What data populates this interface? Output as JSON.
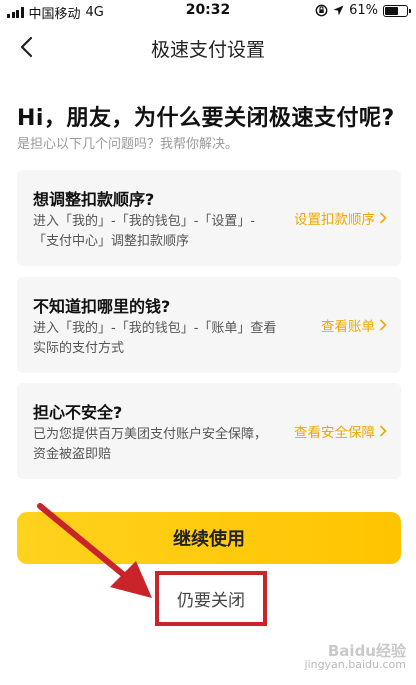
{
  "status_bar": {
    "carrier": "中国移动",
    "network": "4G",
    "time": "20:32",
    "battery": "61%",
    "battery_level": 0.61
  },
  "nav": {
    "title": "极速支付设置"
  },
  "heading": {
    "title": "Hi，朋友，为什么要关闭极速支付呢?",
    "subtitle": "是担心以下几个问题吗？我帮你解决。"
  },
  "cards": [
    {
      "title": "想调整扣款顺序?",
      "description": "进入「我的」-「我的钱包」-「设置」-「支付中心」调整扣款顺序",
      "link": "设置扣款顺序"
    },
    {
      "title": "不知道扣哪里的钱?",
      "description": "进入「我的」-「我的钱包」-「账单」查看实际的支付方式",
      "link": "查看账单"
    },
    {
      "title": "担心不安全?",
      "description": "已为您提供百万美团支付账户安全保障，资金被盗即赔",
      "link": "查看安全保障"
    }
  ],
  "actions": {
    "continue_label": "继续使用",
    "close_label": "仍要关闭"
  },
  "watermark": {
    "brand": "Baidu经验",
    "url": "jingyan.baidu.com"
  },
  "colors": {
    "accent": "#ffc400",
    "link": "#f0a800",
    "highlight_box": "#c8242a"
  }
}
